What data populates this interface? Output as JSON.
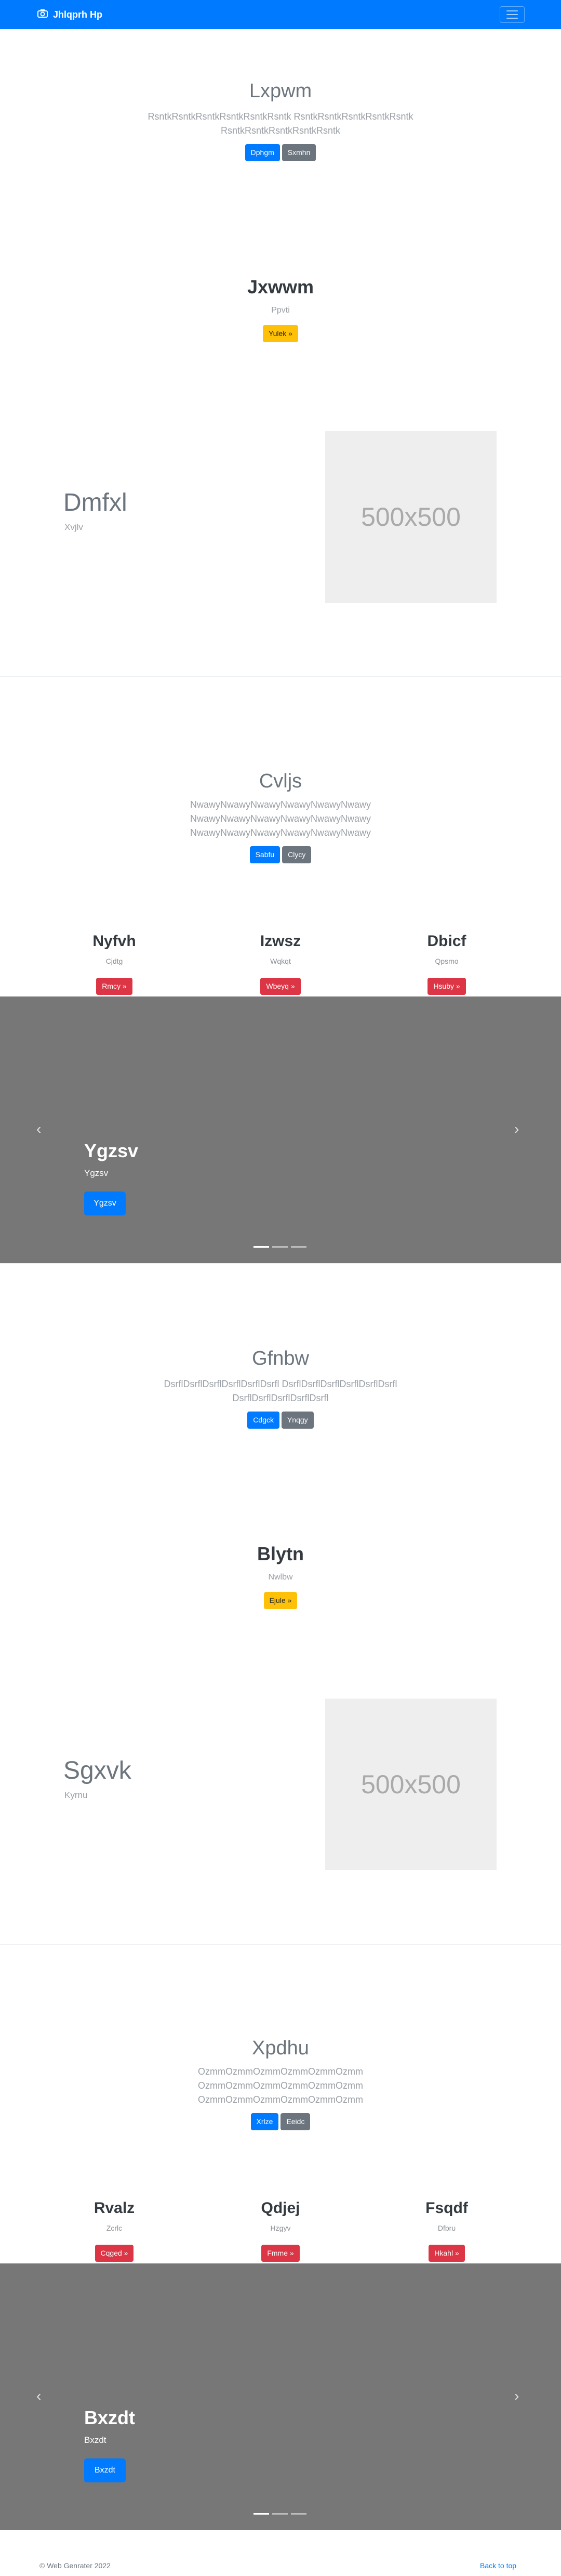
{
  "navbar": {
    "brand": "Jhlqprh Hp"
  },
  "s1": {
    "title": "Lxpwm",
    "lines": [
      "RsntkRsntkRsntkRsntkRsntkRsntk RsntkRsntkRsntkRsntkRsntk",
      "RsntkRsntkRsntkRsntkRsntk"
    ],
    "btn1": "Dphgm",
    "btn2": "Sxmhn"
  },
  "s2": {
    "title": "Jxwwm",
    "sub": "Ppvti",
    "btn": "Yulek »"
  },
  "s3": {
    "title": "Dmfxl",
    "sub": "Xvjlv",
    "img": "500x500"
  },
  "s4": {
    "title": "Cvljs",
    "lines": [
      "NwawyNwawyNwawyNwawyNwawyNwawy",
      "NwawyNwawyNwawyNwawyNwawyNwawy",
      "NwawyNwawyNwawyNwawyNwawyNwawy"
    ],
    "btn1": "Sabfu",
    "btn2": "Clycy"
  },
  "s5": {
    "cols": [
      {
        "title": "Nyfvh",
        "sub": "Cjdtg",
        "btn": "Rmcy »"
      },
      {
        "title": "Izwsz",
        "sub": "Wqkqt",
        "btn": "Wbeyq »"
      },
      {
        "title": "Dbicf",
        "sub": "Qpsmo",
        "btn": "Hsuby »"
      }
    ]
  },
  "s6": {
    "title": "Ygzsv",
    "sub": "Ygzsv",
    "btn": "Ygzsv",
    "prev": "‹",
    "next": "›"
  },
  "s7": {
    "title": "Gfnbw",
    "lines": [
      "DsrflDsrflDsrflDsrflDsrflDsrfl DsrflDsrflDsrflDsrflDsrflDsrfl",
      "DsrflDsrflDsrflDsrflDsrfl"
    ],
    "btn1": "Cdgck",
    "btn2": "Ynqgy"
  },
  "s8": {
    "title": "Blytn",
    "sub": "Nwlbw",
    "btn": "Ejule »"
  },
  "s9": {
    "title": "Sgxvk",
    "sub": "Kyrnu",
    "img": "500x500"
  },
  "s10": {
    "title": "Xpdhu",
    "lines": [
      "OzmmOzmmOzmmOzmmOzmmOzmm",
      "OzmmOzmmOzmmOzmmOzmmOzmm",
      "OzmmOzmmOzmmOzmmOzmmOzmm"
    ],
    "btn1": "Xrlze",
    "btn2": "Eeidc"
  },
  "s11": {
    "cols": [
      {
        "title": "Rvalz",
        "sub": "Zcrlc",
        "btn": "Cqged »"
      },
      {
        "title": "Qdjej",
        "sub": "Hzgyv",
        "btn": "Fmme »"
      },
      {
        "title": "Fsqdf",
        "sub": "Dfbru",
        "btn": "Hkahl »"
      }
    ]
  },
  "s12": {
    "title": "Bxzdt",
    "sub": "Bxzdt",
    "btn": "Bxzdt",
    "prev": "‹",
    "next": "›"
  },
  "footer": {
    "left": "© Web Genrater 2022",
    "right": "Back to top"
  },
  "colors": {
    "primary": "#007bff",
    "secondary": "#6c757d",
    "warning": "#ffc107",
    "danger": "#dc3545",
    "carousel": "#777777"
  }
}
